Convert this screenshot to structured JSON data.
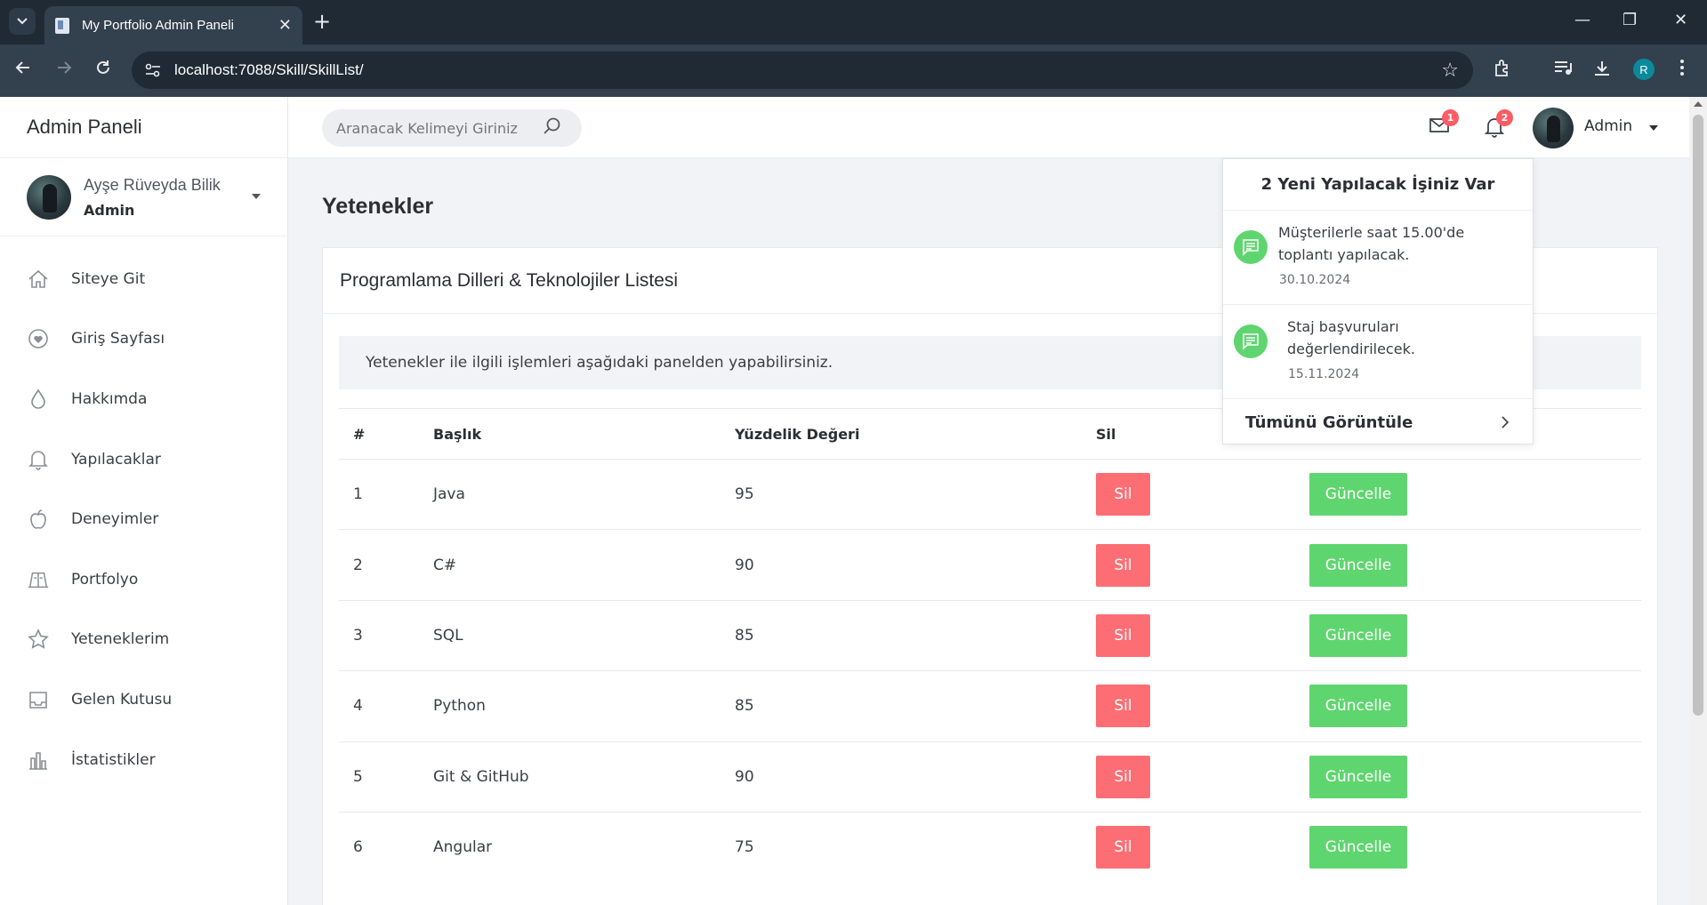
{
  "browser": {
    "tab_title": "My Portfolio Admin Paneli",
    "url": "localhost:7088/Skill/SkillList/",
    "profile_initial": "R"
  },
  "sidebar": {
    "brand": "Admin Paneli",
    "profile_name": "Ayşe Rüveyda Bilik",
    "profile_role": "Admin",
    "items": [
      {
        "label": "Siteye Git",
        "icon": "home-icon"
      },
      {
        "label": "Giriş Sayfası",
        "icon": "heart-icon"
      },
      {
        "label": "Hakkımda",
        "icon": "droplet-icon"
      },
      {
        "label": "Yapılacaklar",
        "icon": "bell-icon"
      },
      {
        "label": "Deneyimler",
        "icon": "apple-icon"
      },
      {
        "label": "Portfolyo",
        "icon": "book-icon"
      },
      {
        "label": "Yeteneklerim",
        "icon": "star-icon"
      },
      {
        "label": "Gelen Kutusu",
        "icon": "inbox-icon"
      },
      {
        "label": "İstatistikler",
        "icon": "bar-chart-icon"
      }
    ]
  },
  "topbar": {
    "search_placeholder": "Aranacak Kelimeyi Giriniz",
    "mail_badge": "1",
    "bell_badge": "2",
    "user_name": "Admin"
  },
  "main": {
    "page_title": "Yetenekler",
    "card_title": "Programlama Dilleri & Teknolojiler Listesi",
    "info_text": "Yetenekler ile ilgili işlemleri aşağıdaki panelden yapabilirsiniz.",
    "columns": [
      "#",
      "Başlık",
      "Yüzdelik Değeri",
      "Sil",
      ""
    ],
    "delete_label": "Sil",
    "update_label": "Güncelle",
    "rows": [
      {
        "no": "1",
        "title": "Java",
        "value": "95"
      },
      {
        "no": "2",
        "title": "C#",
        "value": "90"
      },
      {
        "no": "3",
        "title": "SQL",
        "value": "85"
      },
      {
        "no": "4",
        "title": "Python",
        "value": "85"
      },
      {
        "no": "5",
        "title": "Git & GitHub",
        "value": "90"
      },
      {
        "no": "6",
        "title": "Angular",
        "value": "75"
      }
    ]
  },
  "notifications": {
    "header": "2 Yeni Yapılacak İşiniz Var",
    "items": [
      {
        "text": "Müşterilerle saat 15.00'de toplantı yapılacak.",
        "date": "30.10.2024"
      },
      {
        "text": "Staj başvuruları değerlendirilecek.",
        "date": "15.11.2024"
      }
    ],
    "footer": "Tümünü Görüntüle"
  },
  "colors": {
    "danger": "#fc6e74",
    "success": "#5fd56f",
    "badge": "#fc5c65"
  }
}
